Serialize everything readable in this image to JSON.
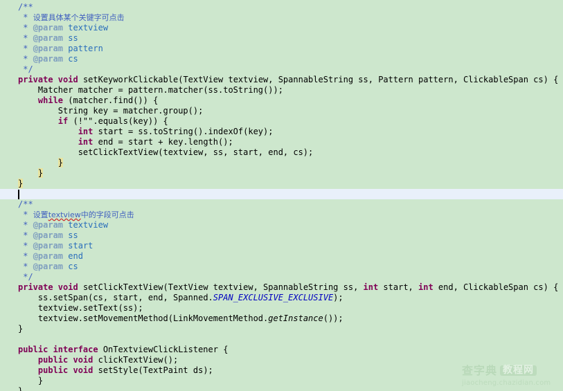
{
  "editor": {
    "background_color": "#cde7cd",
    "caret_line_color": "#e9f0fa",
    "language": "Java",
    "font_size_px": 12,
    "line_height_px": 15,
    "caret_line_index": 17,
    "colors": {
      "keyword": "#7f0055",
      "comment": "#3f5fbf",
      "javadoc_tag": "#7f9fbf",
      "javadoc_param": "#2a6ebb",
      "static_field": "#0000c0",
      "plain_text": "#000000",
      "brace_match_highlight": "#e8e4a0",
      "error_squiggle": "#cc2222"
    }
  },
  "code": {
    "comment_block_1": {
      "open": "/**",
      "line_cn": "设置具体某个关键字可点击",
      "params": [
        "textview",
        "ss",
        "pattern",
        "cs"
      ],
      "param_tag": "@param",
      "close": "*/"
    },
    "method_1": {
      "modifiers": "private void",
      "name": "setKeyworkClickable",
      "signature_rest": "(TextView textview, SpannableString ss, Pattern pattern, ClickableSpan cs) {",
      "body": [
        "Matcher matcher = pattern.matcher(ss.toString());",
        "while (matcher.find()) {",
        "String key = matcher.group();",
        "if (!\"\".equals(key)) {",
        "int start = ss.toString().indexOf(key);",
        "int end = start + key.length();",
        "setClickTextView(textview, ss, start, end, cs);"
      ]
    },
    "comment_block_2": {
      "open": "/**",
      "line_cn_before": "设置",
      "line_cn_word": "textview",
      "line_cn_after": "中的字段可点击",
      "params": [
        "textview",
        "ss",
        "start",
        "end",
        "cs"
      ],
      "param_tag": "@param",
      "close": "*/"
    },
    "method_2": {
      "modifiers": "private void",
      "name": "setClickTextView",
      "signature_rest": "(TextView textview, SpannableString ss, int start, int end, ClickableSpan cs) {",
      "body": [
        "ss.setSpan(cs, start, end, Spanned.SPAN_EXCLUSIVE_EXCLUSIVE);",
        "textview.setText(ss);",
        "textview.setMovementMethod(LinkMovementMethod.getInstance());"
      ],
      "static_field": "SPAN_EXCLUSIVE_EXCLUSIVE",
      "italic_method": "getInstance"
    },
    "interface_block": {
      "declaration": "public interface OnTextviewClickListener {",
      "members": [
        "public void clickTextView();",
        "public void setStyle(TextPaint ds);"
      ]
    },
    "braces": {
      "close": "}"
    }
  },
  "watermark": {
    "brand_cn": "查字典",
    "label_cn": "教程网",
    "url": "jiaocheng.chazidian.com"
  }
}
